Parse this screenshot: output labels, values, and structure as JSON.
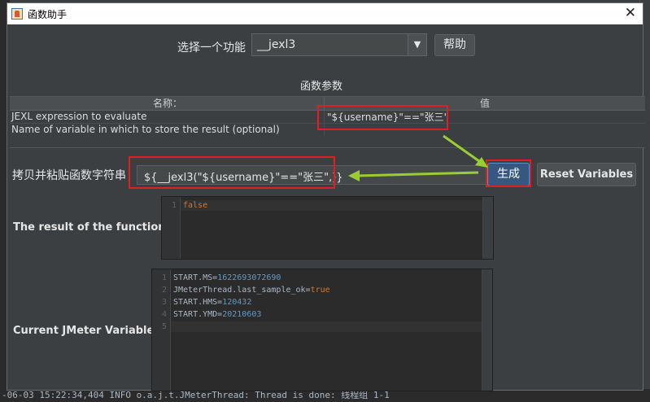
{
  "dialog": {
    "title": "函数助手"
  },
  "function_select": {
    "label": "选择一个功能",
    "selected": "__jexl3",
    "help_label": "帮助"
  },
  "params": {
    "title": "函数参数",
    "col_name": "名称：",
    "col_value": "值",
    "rows": [
      {
        "name": "JEXL expression to evaluate",
        "value": "\"${username}\"==\"张三\""
      },
      {
        "name": "Name of variable in which to store the result (optional)",
        "value": ""
      }
    ]
  },
  "copy": {
    "label": "拷贝并粘贴函数字符串",
    "value": "${__jexl3(\"${username}\"==\"张三\",)}",
    "generate_label": "生成",
    "reset_label": "Reset Variables"
  },
  "result": {
    "label": "The result of the function is",
    "lines": [
      {
        "n": "1",
        "text": "false"
      }
    ]
  },
  "variables": {
    "label": "Current JMeter Variables",
    "lines": [
      {
        "n": "1",
        "key": "START.MS=",
        "val": "1622693072690"
      },
      {
        "n": "2",
        "key": "JMeterThread.last_sample_ok=",
        "val": "true"
      },
      {
        "n": "3",
        "key": "START.HMS=",
        "val": "120432"
      },
      {
        "n": "4",
        "key": "START.YMD=",
        "val": "20210603"
      },
      {
        "n": "5",
        "key": "",
        "val": ""
      }
    ]
  },
  "background_log": "-06-03 15:22:34,404 INFO o.a.j.t.JMeterThread: Thread is done: 线程组 1-1",
  "colors": {
    "annotation_red": "#e02020",
    "annotation_arrow": "#9acd32",
    "keyword": "#cc7832",
    "number": "#6897bb"
  }
}
